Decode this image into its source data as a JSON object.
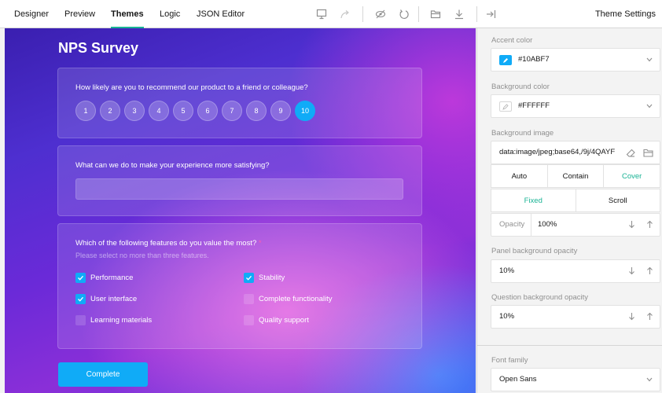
{
  "tabs": [
    "Designer",
    "Preview",
    "Themes",
    "Logic",
    "JSON Editor"
  ],
  "active_tab": "Themes",
  "toolbar_icons": [
    "device-icon",
    "redo-icon",
    "hide-icon",
    "undo-icon",
    "open-folder-icon",
    "download-icon"
  ],
  "panel": {
    "title": "Theme Settings",
    "collapse_icon": "collapse-panel-icon"
  },
  "survey": {
    "title": "NPS Survey",
    "q1": {
      "title": "How likely are you to recommend our product to a friend or colleague?",
      "rates": [
        "1",
        "2",
        "3",
        "4",
        "5",
        "6",
        "7",
        "8",
        "9",
        "10"
      ],
      "selected": "10"
    },
    "q2": {
      "title": "What can we do to make your experience more satisfying?"
    },
    "q3": {
      "title": "Which of the following features do you value the most?",
      "required_mark": "*",
      "description": "Please select no more than three features.",
      "choices": [
        {
          "label": "Performance",
          "checked": true
        },
        {
          "label": "Stability",
          "checked": true
        },
        {
          "label": "User interface",
          "checked": true
        },
        {
          "label": "Complete functionality",
          "checked": false
        },
        {
          "label": "Learning materials",
          "checked": false
        },
        {
          "label": "Quality support",
          "checked": false
        }
      ]
    },
    "complete_label": "Complete"
  },
  "settings": {
    "accent_label": "Accent color",
    "accent_value": "#10ABF7",
    "accent_color": "#10abf7",
    "bg_label": "Background color",
    "bg_value": "#FFFFFF",
    "bgimg_label": "Background image",
    "bgimg_value": "data:image/jpeg;base64,/9j/4QAYF",
    "fit_options": [
      "Auto",
      "Contain",
      "Cover"
    ],
    "fit_selected": "Cover",
    "attach_options": [
      "Fixed",
      "Scroll"
    ],
    "attach_selected": "Fixed",
    "opacity_label": "Opacity",
    "opacity_value": "100%",
    "panel_opacity_label": "Panel background opacity",
    "panel_opacity_value": "10%",
    "question_opacity_label": "Question background opacity",
    "question_opacity_value": "10%",
    "font_label": "Font family",
    "font_value": "Open Sans"
  },
  "colors": {
    "accent": "#10abf7",
    "green": "#19b394"
  }
}
